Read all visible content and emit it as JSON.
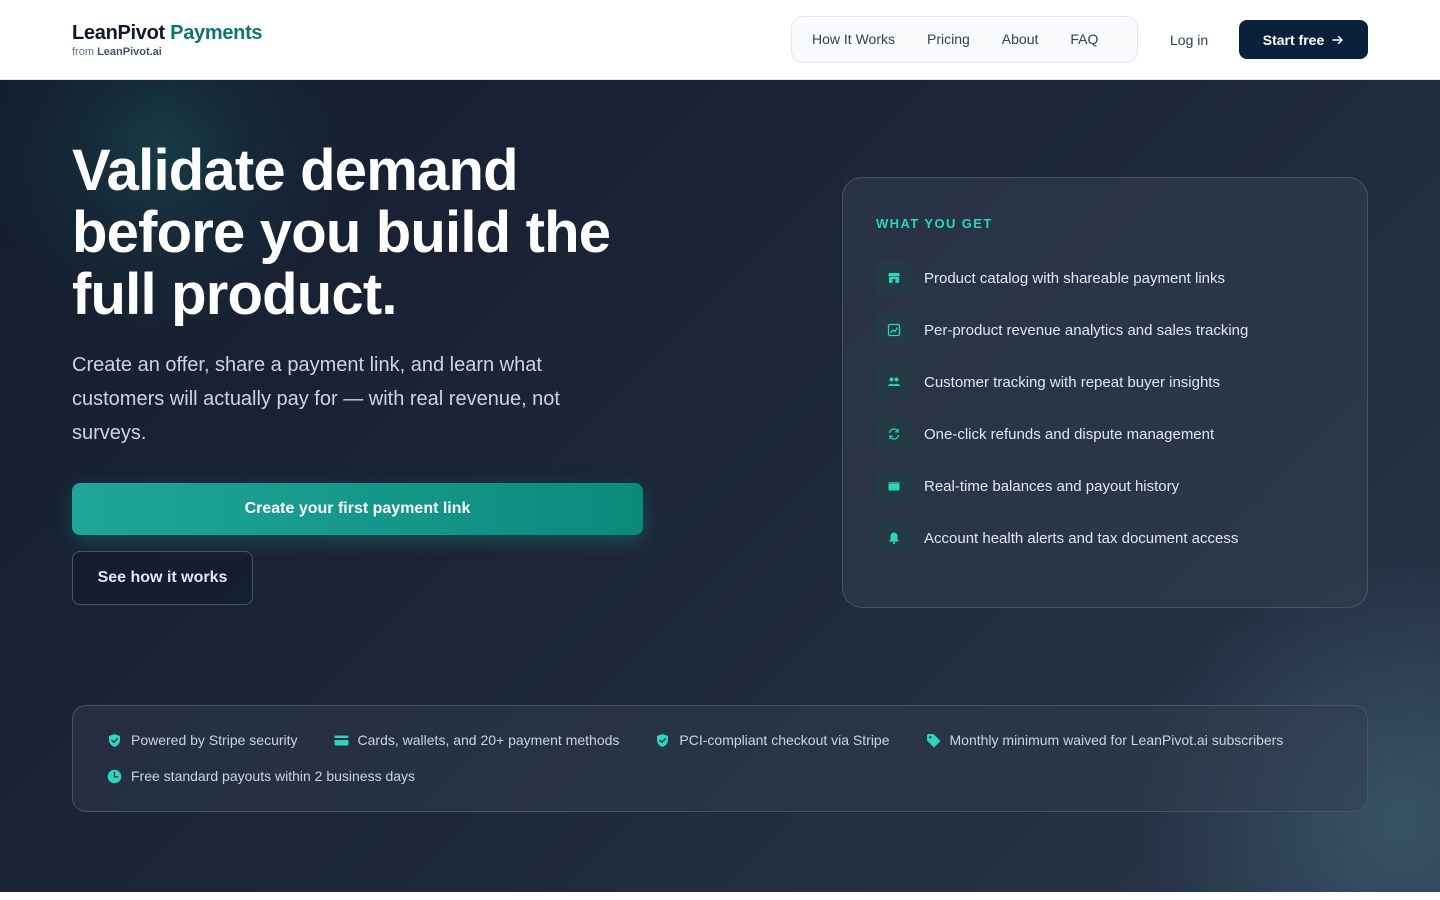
{
  "header": {
    "brand_primary": "LeanPivot",
    "brand_accent": "Payments",
    "brand_from": "from",
    "brand_parent": "LeanPivot.ai",
    "nav": [
      {
        "label": "How It Works"
      },
      {
        "label": "Pricing"
      },
      {
        "label": "About"
      },
      {
        "label": "FAQ"
      }
    ],
    "login_label": "Log in",
    "start_label": "Start free"
  },
  "hero": {
    "headline": "Validate demand before you build the full product.",
    "subcopy": "Create an offer, share a payment link, and learn what customers will actually pay for — with real revenue, not surveys.",
    "primary_cta": "Create your first payment link",
    "secondary_cta": "See how it works"
  },
  "features": {
    "label": "WHAT YOU GET",
    "items": [
      {
        "text": "Product catalog with shareable payment links",
        "icon": "store-icon"
      },
      {
        "text": "Per-product revenue analytics and sales tracking",
        "icon": "chart-icon"
      },
      {
        "text": "Customer tracking with repeat buyer insights",
        "icon": "users-icon"
      },
      {
        "text": "One-click refunds and dispute management",
        "icon": "refresh-icon"
      },
      {
        "text": "Real-time balances and payout history",
        "icon": "wallet-icon"
      },
      {
        "text": "Account health alerts and tax document access",
        "icon": "bell-icon"
      }
    ]
  },
  "trust": {
    "items": [
      {
        "text": "Powered by Stripe security",
        "icon": "shield-check-icon"
      },
      {
        "text": "Cards, wallets, and 20+ payment methods",
        "icon": "credit-card-icon"
      },
      {
        "text": "PCI-compliant checkout via Stripe",
        "icon": "shield-check-icon"
      },
      {
        "text": "Monthly minimum waived for LeanPivot.ai subscribers",
        "icon": "tag-icon"
      },
      {
        "text": "Free standard payouts within 2 business days",
        "icon": "clock-icon"
      }
    ]
  },
  "colors": {
    "accent": "#14b8a6",
    "brand_dark": "#0b213b",
    "brand_teal": "#0f766e"
  }
}
